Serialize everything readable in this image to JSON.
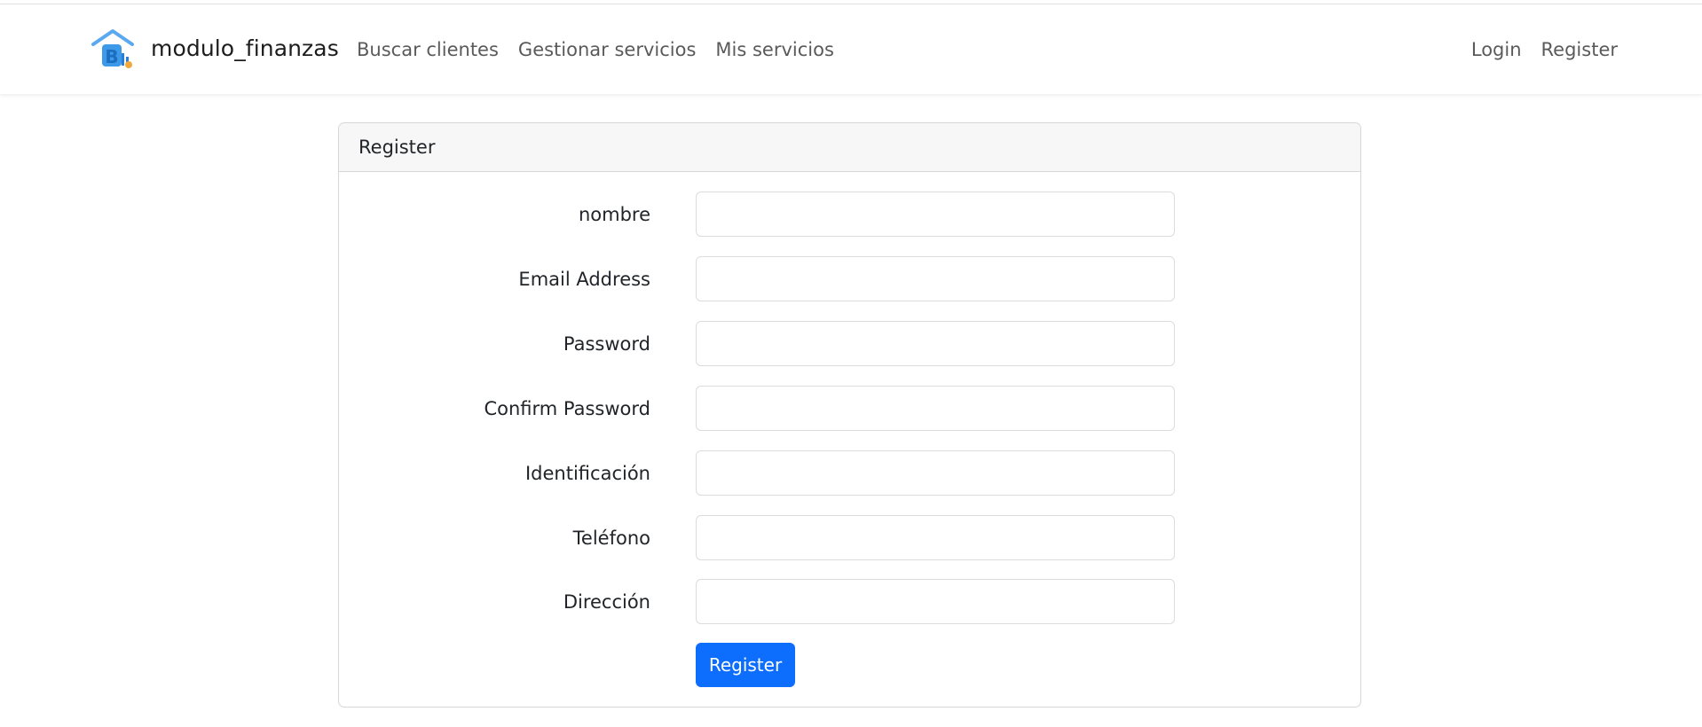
{
  "navbar": {
    "brand": "modulo_finanzas",
    "brand_logo_icon": "house-logo-icon",
    "left_links": [
      "Buscar clientes",
      "Gestionar servicios",
      "Mis servicios"
    ],
    "right_links": [
      "Login",
      "Register"
    ]
  },
  "form": {
    "header": "Register",
    "fields": [
      {
        "label": "nombre",
        "value": "",
        "type": "text"
      },
      {
        "label": "Email Address",
        "value": "",
        "type": "email"
      },
      {
        "label": "Password",
        "value": "",
        "type": "password"
      },
      {
        "label": "Confirm Password",
        "value": "",
        "type": "password"
      },
      {
        "label": "Identificación",
        "value": "",
        "type": "text"
      },
      {
        "label": "Teléfono",
        "value": "",
        "type": "text"
      },
      {
        "label": "Dirección",
        "value": "",
        "type": "text"
      }
    ],
    "submit_label": "Register"
  },
  "colors": {
    "primary": "#0d6efd",
    "nav_link": "#595959",
    "card_header_bg": "#f7f7f7",
    "border": "#d6d6d6"
  }
}
